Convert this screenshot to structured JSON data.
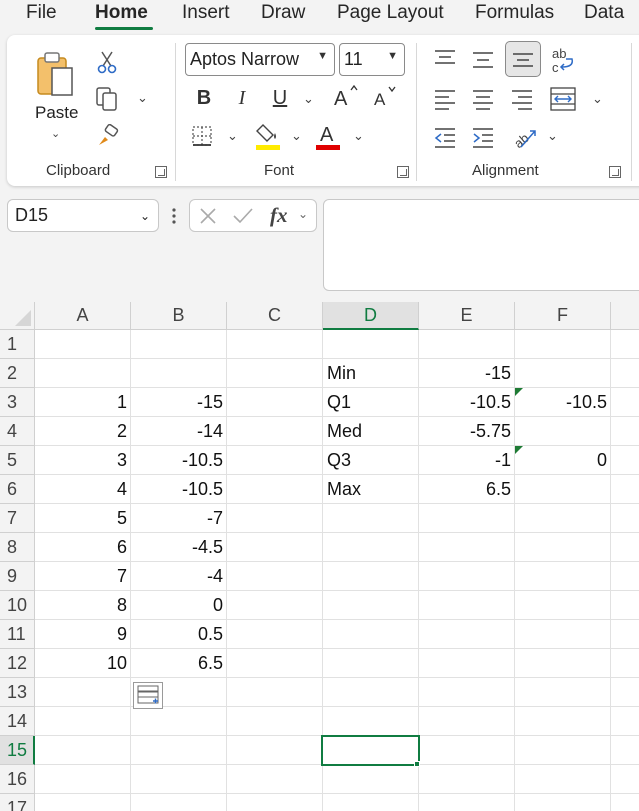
{
  "menu": {
    "tabs": [
      "File",
      "Home",
      "Insert",
      "Draw",
      "Page Layout",
      "Formulas",
      "Data"
    ],
    "active": "Home"
  },
  "ribbon": {
    "clipboard": {
      "paste_label": "Paste",
      "group_label": "Clipboard"
    },
    "font": {
      "name": "Aptos Narrow",
      "size": "11",
      "group_label": "Font",
      "bold": "B",
      "italic": "I",
      "underline": "U",
      "highlight_color": "#ffeb00",
      "font_color": "#e00000"
    },
    "alignment": {
      "group_label": "Alignment"
    }
  },
  "formula_bar": {
    "name_box": "D15",
    "formula": ""
  },
  "sheet": {
    "columns": [
      "A",
      "B",
      "C",
      "D",
      "E",
      "F"
    ],
    "rows": [
      "1",
      "2",
      "3",
      "4",
      "5",
      "6",
      "7",
      "8",
      "9",
      "10",
      "11",
      "12",
      "13",
      "14",
      "15",
      "16",
      "17"
    ],
    "selected_column": "D",
    "selected_row": "15",
    "cells": {
      "A3": "1",
      "B3": "-15",
      "A4": "2",
      "B4": "-14",
      "A5": "3",
      "B5": "-10.5",
      "A6": "4",
      "B6": "-10.5",
      "A7": "5",
      "B7": "-7",
      "A8": "6",
      "B8": "-4.5",
      "A9": "7",
      "B9": "-4",
      "A10": "8",
      "B10": "0",
      "A11": "9",
      "B11": "0.5",
      "A12": "10",
      "B12": "6.5",
      "D2": "Min",
      "E2": "-15",
      "D3": "Q1",
      "E3": "-10.5",
      "F3": "-10.5",
      "D4": "Med",
      "E4": "-5.75",
      "D5": "Q3",
      "E5": "-1",
      "F5": "0",
      "D6": "Max",
      "E6": "6.5"
    }
  },
  "colors": {
    "accent": "#107c41",
    "error_indicator": "#1e7b34"
  }
}
